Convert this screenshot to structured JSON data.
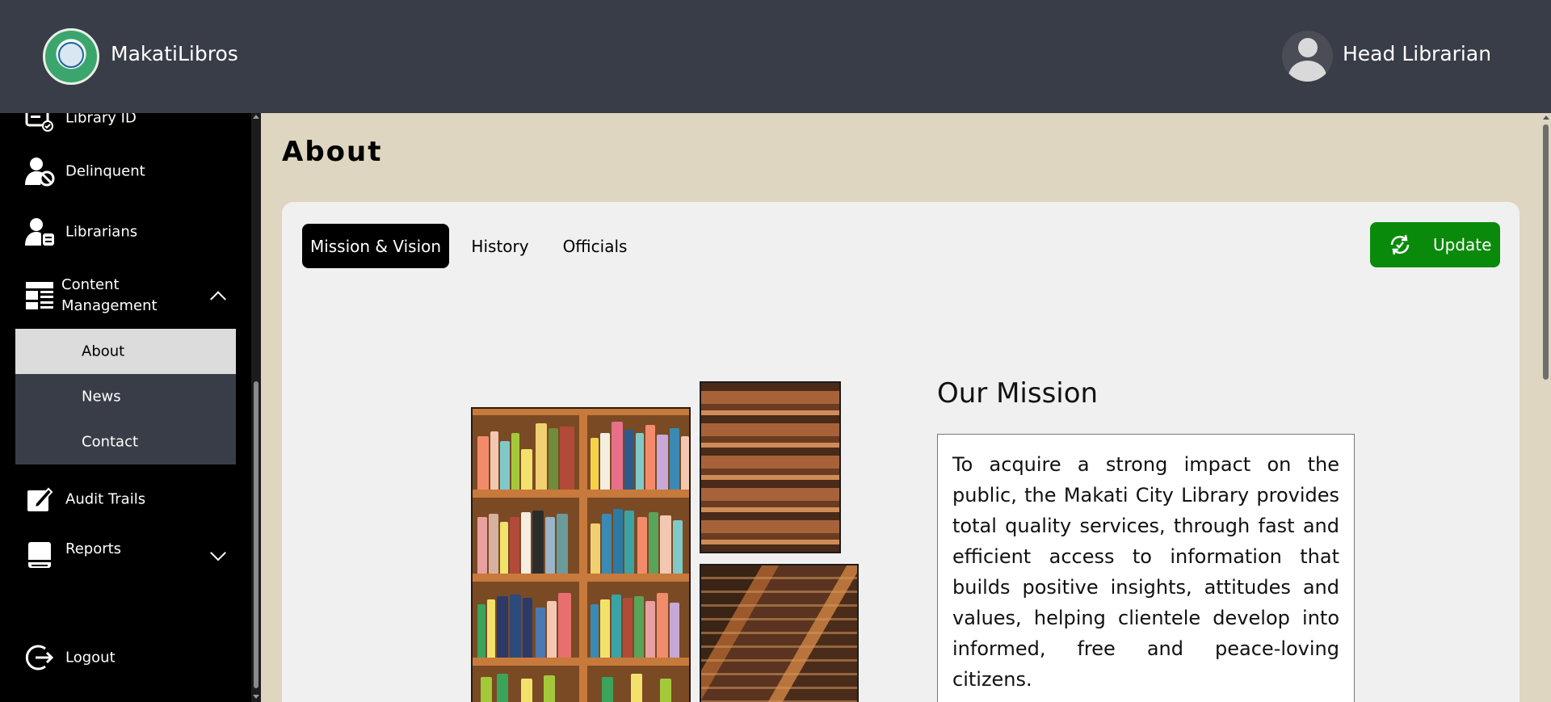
{
  "app": {
    "name": "MakatiLibros"
  },
  "user": {
    "role": "Head Librarian"
  },
  "sidebar": {
    "items": [
      {
        "label": "Library ID",
        "icon": "library-id-icon"
      },
      {
        "label": "Delinquent",
        "icon": "user-block-icon"
      },
      {
        "label": "Librarians",
        "icon": "librarian-icon"
      },
      {
        "label": "Content Management",
        "icon": "content-icon"
      },
      {
        "label": "Audit Trails",
        "icon": "edit-icon"
      },
      {
        "label": "Reports",
        "icon": "report-icon"
      },
      {
        "label": "Logout",
        "icon": "logout-icon"
      }
    ],
    "content_sub": [
      {
        "label": "About"
      },
      {
        "label": "News"
      },
      {
        "label": "Contact"
      }
    ]
  },
  "page": {
    "title": "About"
  },
  "tabs": [
    {
      "label": "Mission & Vision"
    },
    {
      "label": "History"
    },
    {
      "label": "Officials"
    }
  ],
  "actions": {
    "update_label": "Update"
  },
  "mission": {
    "title": "Our Mission",
    "text": "To acquire a strong impact on the public, the Makati City Library provides total quality services, through fast and efficient access to information that builds positive insights, attitudes and values, helping clientele develop into informed, free and peace-loving citizens."
  },
  "colors": {
    "header": "#393d47",
    "sidebar": "#000000",
    "background": "#ded6c0",
    "card": "#f0f0f0",
    "accent": "#0a8a0a"
  }
}
